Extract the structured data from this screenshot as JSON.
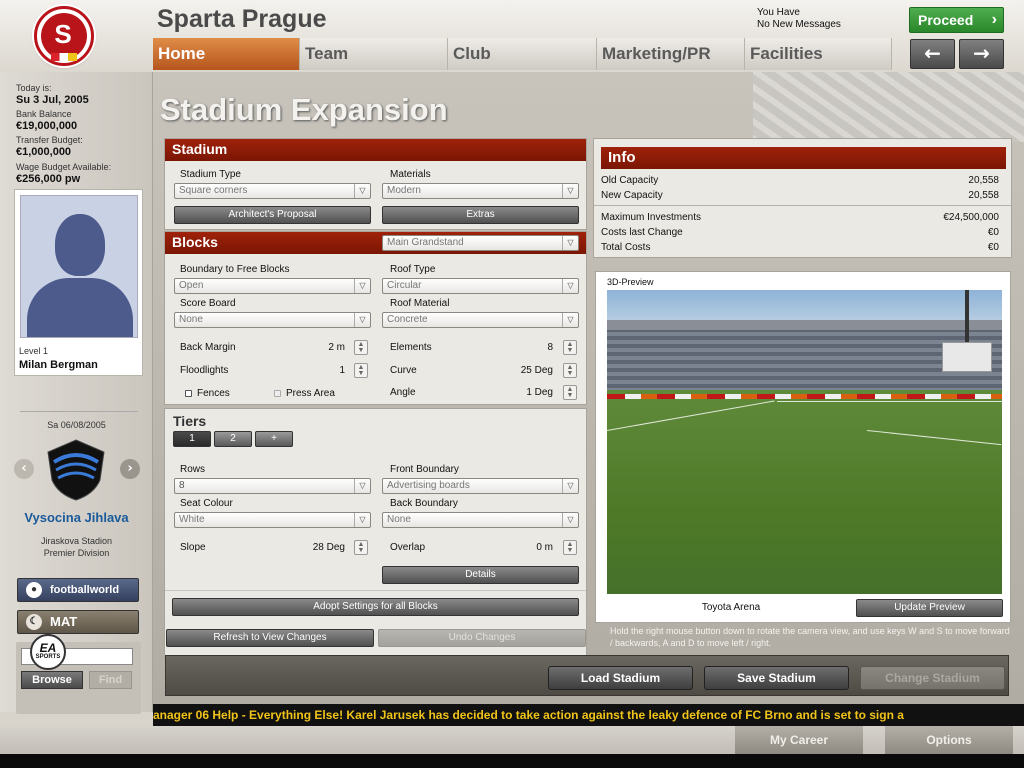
{
  "header": {
    "club_name": "Sparta Prague",
    "messages_line1": "You Have",
    "messages_line2": "No New Messages",
    "proceed_label": "Proceed",
    "back_icon": "←",
    "forward_icon": "→",
    "tabs": [
      {
        "label": "Home",
        "active": true
      },
      {
        "label": "Team",
        "active": false
      },
      {
        "label": "Club",
        "active": false
      },
      {
        "label": "Marketing/PR",
        "active": false
      },
      {
        "label": "Facilities",
        "active": false
      }
    ]
  },
  "sidebar": {
    "today_label": "Today is:",
    "today_value": "Su 3 Jul, 2005",
    "bank_label": "Bank Balance",
    "bank_value": "€19,000,000",
    "transfer_label": "Transfer Budget:",
    "transfer_value": "€1,000,000",
    "wage_label": "Wage Budget Available:",
    "wage_value": "€256,000 pw",
    "manager_level": "Level 1",
    "manager_name": "Milan Bergman",
    "next_match_date": "Sa 06/08/2005",
    "opponent_name": "Vysocina Jihlava",
    "opponent_stadium": "Jiraskova Stadion",
    "opponent_division": "Premier Division",
    "footballworld_label": "footballworld",
    "mat_label": "MAT",
    "search_value": "",
    "browse_label": "Browse",
    "find_label": "Find"
  },
  "main": {
    "page_title": "Stadium Expansion",
    "stadium": {
      "header": "Stadium",
      "type_label": "Stadium Type",
      "type_value": "Square corners",
      "materials_label": "Materials",
      "materials_value": "Modern",
      "architect_button": "Architect's Proposal",
      "extras_button": "Extras"
    },
    "blocks": {
      "header": "Blocks",
      "block_select": "Main Grandstand",
      "boundary_free_label": "Boundary to Free Blocks",
      "boundary_free_value": "Open",
      "roof_type_label": "Roof Type",
      "roof_type_value": "Circular",
      "scoreboard_label": "Score Board",
      "scoreboard_value": "None",
      "roof_material_label": "Roof Material",
      "roof_material_value": "Concrete",
      "back_margin_label": "Back Margin",
      "back_margin_value": "2 m",
      "elements_label": "Elements",
      "elements_value": "8",
      "floodlights_label": "Floodlights",
      "floodlights_value": "1",
      "curve_label": "Curve",
      "curve_value": "25 Deg",
      "fences_label": "Fences",
      "press_area_label": "Press Area",
      "angle_label": "Angle",
      "angle_value": "1 Deg"
    },
    "tiers": {
      "header": "Tiers",
      "tier_buttons": [
        "1",
        "2",
        "+"
      ],
      "rows_label": "Rows",
      "rows_value": "8",
      "front_boundary_label": "Front Boundary",
      "front_boundary_value": "Advertising boards",
      "seat_colour_label": "Seat Colour",
      "seat_colour_value": "White",
      "back_boundary_label": "Back Boundary",
      "back_boundary_value": "None",
      "slope_label": "Slope",
      "slope_value": "28 Deg",
      "overlap_label": "Overlap",
      "overlap_value": "0 m",
      "details_button": "Details"
    },
    "adopt_button": "Adopt Settings for all Blocks",
    "refresh_button": "Refresh to View Changes",
    "undo_button": "Undo Changes",
    "info": {
      "header": "Info",
      "old_capacity_label": "Old Capacity",
      "old_capacity_value": "20,558",
      "new_capacity_label": "New Capacity",
      "new_capacity_value": "20,558",
      "max_invest_label": "Maximum Investments",
      "max_invest_value": "€24,500,000",
      "costs_last_label": "Costs last Change",
      "costs_last_value": "€0",
      "total_costs_label": "Total Costs",
      "total_costs_value": "€0"
    },
    "preview": {
      "label": "3D-Preview",
      "stadium_name": "Toyota Arena",
      "update_button": "Update Preview",
      "help_text": "Hold the right mouse button down to rotate the camera view, and use keys W and S to move forward / backwards, A and D to move left / right."
    },
    "load_button": "Load Stadium",
    "save_button": "Save Stadium",
    "change_button": "Change Stadium"
  },
  "ticker": {
    "text": "anager 06 Help - Everything Else!     Karel Jarusek has decided to take action against the leaky defence of FC Brno and is set to sign a"
  },
  "footer": {
    "career_label": "My Career",
    "options_label": "Options"
  },
  "colors": {
    "accent_red": "#8a1a06",
    "tab_active": "#c8692e",
    "proceed_green": "#3a9a3a",
    "ticker_text": "#f0c419"
  }
}
